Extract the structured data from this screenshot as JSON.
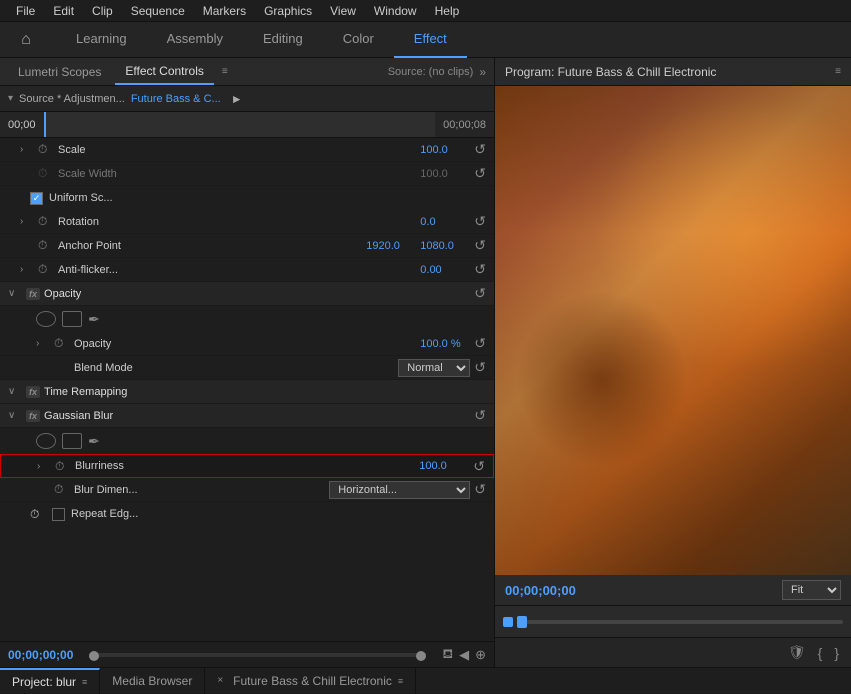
{
  "menu": {
    "items": [
      "File",
      "Edit",
      "Clip",
      "Sequence",
      "Markers",
      "Graphics",
      "View",
      "Window",
      "Help"
    ]
  },
  "workspace_tabs": {
    "home_icon": "⌂",
    "tabs": [
      "Learning",
      "Assembly",
      "Editing",
      "Color",
      "Effect"
    ]
  },
  "left_panel": {
    "tabs": [
      {
        "label": "Lumetri Scopes",
        "active": false
      },
      {
        "label": "Effect Controls",
        "active": true
      },
      {
        "label": "≡",
        "active": false
      }
    ],
    "source_label": "Source: (no clips)",
    "expand_icon": "»",
    "source_row": {
      "dropdown_icon": "▾",
      "source_text": "Source * Adjustmen...",
      "clip_link": "Future Bass & C...",
      "play_icon": "►"
    },
    "timeline": {
      "start": "00;00",
      "end": "00;00;08"
    },
    "effect_controls": {
      "groups": [
        {
          "type": "property",
          "indent": 1,
          "expand": "›",
          "stopwatch": true,
          "label": "Scale",
          "value": "100.0",
          "reset": "↺"
        },
        {
          "type": "property",
          "indent": 1,
          "expand": "",
          "stopwatch": true,
          "label": "Scale Width",
          "value": "100.0",
          "dim": true,
          "reset": "↺"
        },
        {
          "type": "checkbox",
          "indent": 1,
          "label": "Uniform Sc...",
          "checked": true
        },
        {
          "type": "property",
          "indent": 1,
          "expand": "›",
          "stopwatch": true,
          "label": "Rotation",
          "value": "0.0",
          "reset": "↺"
        },
        {
          "type": "property",
          "indent": 1,
          "expand": "",
          "stopwatch": true,
          "label": "Anchor Point",
          "value1": "1920.0",
          "value2": "1080.0",
          "reset": "↺"
        },
        {
          "type": "property",
          "indent": 1,
          "expand": "›",
          "stopwatch": true,
          "label": "Anti-flicker...",
          "value": "0.00",
          "reset": "↺"
        },
        {
          "type": "section_header",
          "fx": true,
          "label": "Opacity",
          "reset": "↺"
        },
        {
          "type": "shape_tools"
        },
        {
          "type": "property",
          "indent": 2,
          "expand": "›",
          "stopwatch": true,
          "label": "Opacity",
          "value": "100.0 %",
          "reset": "↺"
        },
        {
          "type": "blend_mode",
          "indent": 2,
          "label": "Blend Mode",
          "value": "Normal",
          "reset": "↺"
        },
        {
          "type": "section_header_collapsed",
          "fx": true,
          "label": "Time Remapping"
        },
        {
          "type": "section_header",
          "fx": true,
          "label": "Gaussian Blur",
          "reset": "↺"
        },
        {
          "type": "shape_tools2"
        },
        {
          "type": "property_highlighted",
          "indent": 2,
          "expand": "›",
          "stopwatch": true,
          "label": "Blurriness",
          "value": "100.0",
          "reset": "↺"
        },
        {
          "type": "blur_dimen",
          "indent": 2,
          "label": "Blur Dimen...",
          "value": "Horizontal...",
          "reset": "↺"
        },
        {
          "type": "repeat_edge",
          "indent": 2,
          "label": "Repeat Edg...",
          "checked": false
        }
      ]
    },
    "bottom_timecode": "00;00;00;00",
    "bottom_controls": [
      "◈",
      "◀◀",
      "◀",
      "▶",
      "▶▶",
      "⊕"
    ]
  },
  "right_panel": {
    "title": "Program: Future Bass & Chill Electronic",
    "menu_icon": "≡",
    "timecode": "00;00;00;00",
    "fit_label": "Fit",
    "preview_ctrl_icons": [
      "🛡",
      "⊢",
      "⊣"
    ]
  },
  "bottom_tabs": [
    {
      "label": "Project: blur",
      "icon": "≡",
      "active": true
    },
    {
      "label": "Media Browser",
      "active": false
    },
    {
      "label": "Future Bass & Chill Electronic",
      "icon": "≡",
      "close": "×",
      "active": false
    }
  ]
}
